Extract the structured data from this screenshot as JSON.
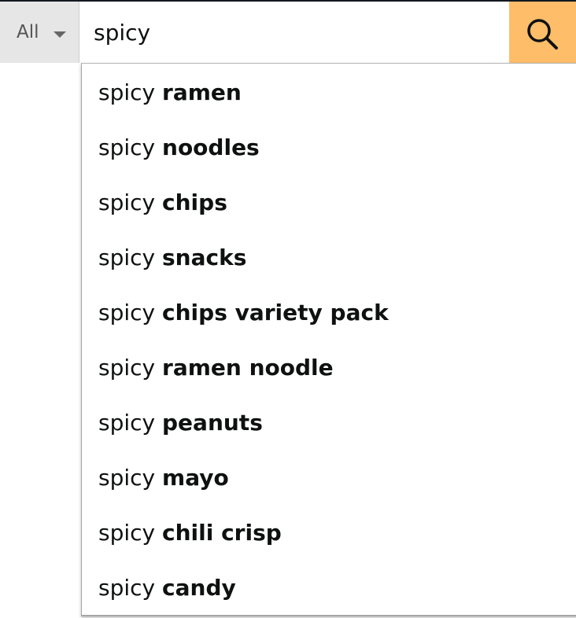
{
  "search": {
    "category": "All",
    "query": "spicy"
  },
  "icons": {
    "category_caret": "caret-down-icon",
    "search_button": "magnifying-glass-icon"
  },
  "colors": {
    "search_button_bg": "#febd69",
    "category_bg": "#e6e6e6",
    "text": "#0f1111"
  },
  "suggestions": [
    {
      "prefix": "spicy",
      "completion": "ramen"
    },
    {
      "prefix": "spicy",
      "completion": "noodles"
    },
    {
      "prefix": "spicy",
      "completion": "chips"
    },
    {
      "prefix": "spicy",
      "completion": "snacks"
    },
    {
      "prefix": "spicy",
      "completion": "chips variety pack"
    },
    {
      "prefix": "spicy",
      "completion": "ramen noodle"
    },
    {
      "prefix": "spicy",
      "completion": "peanuts"
    },
    {
      "prefix": "spicy",
      "completion": "mayo"
    },
    {
      "prefix": "spicy",
      "completion": "chili crisp"
    },
    {
      "prefix": "spicy",
      "completion": "candy"
    }
  ]
}
